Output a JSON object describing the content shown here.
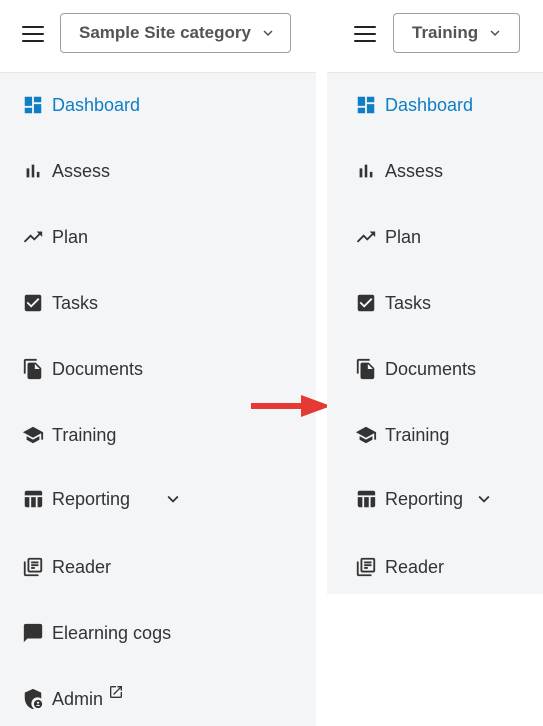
{
  "colors": {
    "accent": "#0f7ec4",
    "arrow": "#e53935",
    "nav_bg": "#f4f5f7",
    "text": "#333333"
  },
  "left_panel": {
    "category_label": "Sample Site category",
    "nav": [
      {
        "label": "Dashboard",
        "icon": "dashboard-icon",
        "active": true
      },
      {
        "label": "Assess",
        "icon": "bar-chart-icon"
      },
      {
        "label": "Plan",
        "icon": "trending-up-icon"
      },
      {
        "label": "Tasks",
        "icon": "checkbox-icon"
      },
      {
        "label": "Documents",
        "icon": "documents-icon"
      },
      {
        "label": "Training",
        "icon": "graduation-cap-icon"
      },
      {
        "label": "Reporting",
        "icon": "table-icon",
        "expandable": true
      },
      {
        "label": "Reader",
        "icon": "reader-icon"
      },
      {
        "label": "Elearning cogs",
        "icon": "chat-bubble-icon"
      },
      {
        "label": "Admin",
        "icon": "admin-shield-icon",
        "external": true
      }
    ]
  },
  "right_panel": {
    "category_label": "Training",
    "nav": [
      {
        "label": "Dashboard",
        "icon": "dashboard-icon",
        "active": true
      },
      {
        "label": "Assess",
        "icon": "bar-chart-icon"
      },
      {
        "label": "Plan",
        "icon": "trending-up-icon"
      },
      {
        "label": "Tasks",
        "icon": "checkbox-icon"
      },
      {
        "label": "Documents",
        "icon": "documents-icon"
      },
      {
        "label": "Training",
        "icon": "graduation-cap-icon"
      },
      {
        "label": "Reporting",
        "icon": "table-icon",
        "expandable": true
      },
      {
        "label": "Reader",
        "icon": "reader-icon"
      }
    ]
  }
}
